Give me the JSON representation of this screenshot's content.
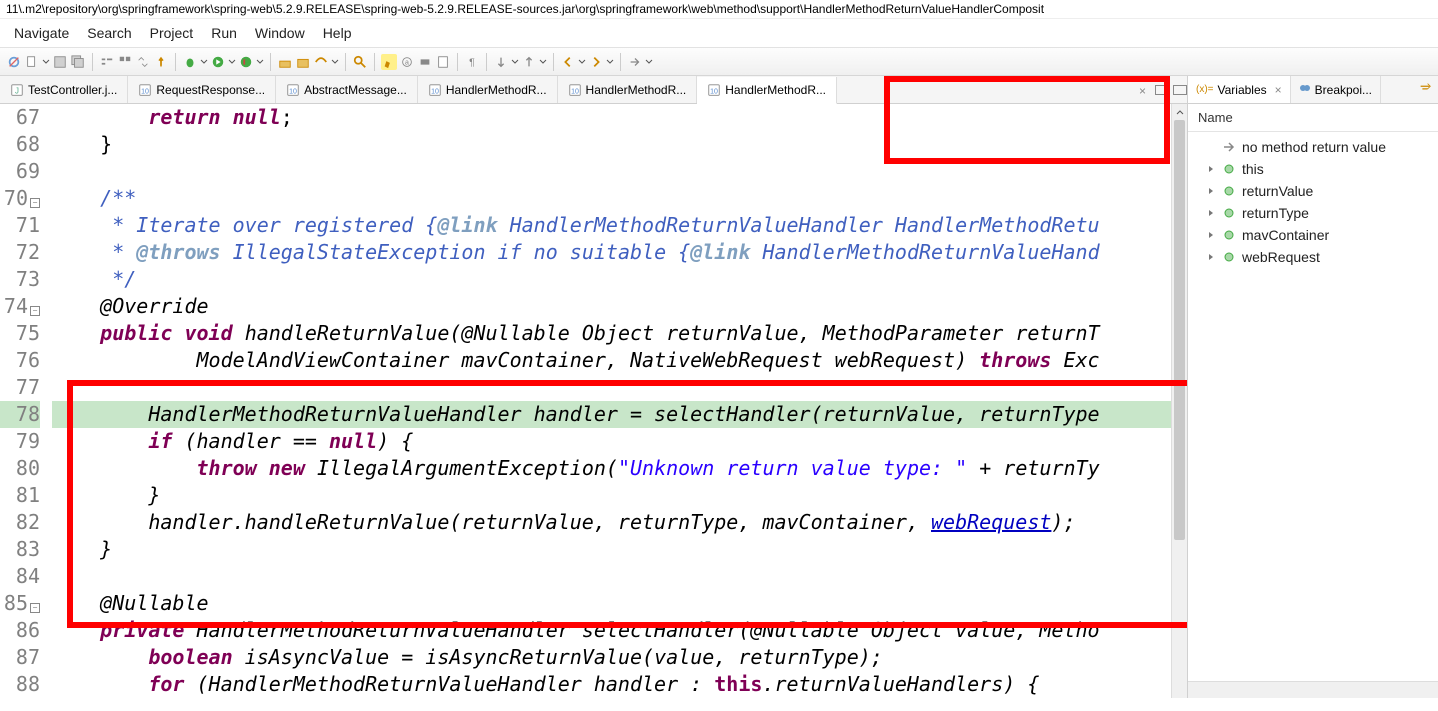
{
  "title": "11\\.m2\\repository\\org\\springframework\\spring-web\\5.2.9.RELEASE\\spring-web-5.2.9.RELEASE-sources.jar\\org\\springframework\\web\\method\\support\\HandlerMethodReturnValueHandlerComposit",
  "menu": [
    "Navigate",
    "Search",
    "Project",
    "Run",
    "Window",
    "Help"
  ],
  "tabs": [
    {
      "label": "TestController.j...",
      "icon": "java"
    },
    {
      "label": "RequestResponse...",
      "icon": "class"
    },
    {
      "label": "AbstractMessage...",
      "icon": "class"
    },
    {
      "label": "HandlerMethodR...",
      "icon": "class"
    },
    {
      "label": "HandlerMethodR...",
      "icon": "class"
    },
    {
      "label": "HandlerMethodR...",
      "icon": "class",
      "active": true
    }
  ],
  "tab_tools": {
    "close_x": "×"
  },
  "code": {
    "lines": [
      {
        "n": 67,
        "html": "        <span class='kw'>return</span> <span class='kw'>null</span>;"
      },
      {
        "n": 68,
        "html": "    }"
      },
      {
        "n": 69,
        "html": ""
      },
      {
        "n": 70,
        "html": "    <span class='jd'>/**</span>",
        "fold": true
      },
      {
        "n": 71,
        "html": "    <span class='jd'> * Iterate over registered {</span><span class='cmtag'>@link</span><span class='jd'> HandlerMethodReturnValueHandler HandlerMethodRetu</span>"
      },
      {
        "n": 72,
        "html": "    <span class='jd'> * </span><span class='cmtag'>@throws</span><span class='jd'> IllegalStateException if no suitable {</span><span class='cmtag'>@link</span><span class='jd'> HandlerMethodReturnValueHand</span>"
      },
      {
        "n": 73,
        "html": "    <span class='jd'> */</span>"
      },
      {
        "n": 74,
        "html": "    <span class='id'>@Override</span>",
        "fold": true
      },
      {
        "n": 75,
        "html": "    <span class='kw'>public</span> <span class='kw'>void</span> <span class='id'>handleReturnValue(@Nullable Object returnValue, MethodParameter returnT</span>"
      },
      {
        "n": 76,
        "html": "            <span class='id'>ModelAndViewContainer mavContainer, NativeWebRequest webRequest)</span> <span class='kw'>throws</span> <span class='id'>Exc</span>"
      },
      {
        "n": 77,
        "html": ""
      },
      {
        "n": 78,
        "html": "        <span class='id'>HandlerMethodReturnValueHandler handler = selectHandler(returnValue, returnType</span>",
        "hl": true
      },
      {
        "n": 79,
        "html": "        <span class='kw'>if</span> <span class='id'>(handler == </span><span class='kw'>null</span><span class='id'>) {</span>"
      },
      {
        "n": 80,
        "html": "            <span class='kw'>throw</span> <span class='kw'>new</span> <span class='id'>IllegalArgumentException(</span><span class='str'>\"Unknown return value type: \"</span><span class='id'> + returnTy</span>"
      },
      {
        "n": 81,
        "html": "        <span class='id'>}</span>"
      },
      {
        "n": 82,
        "html": "        <span class='id'>handler.handleReturnValue(returnValue, returnType, mavContainer, </span><span class='lnk'>webRequest</span><span class='id'>);</span>"
      },
      {
        "n": 83,
        "html": "    <span class='id'>}</span>"
      },
      {
        "n": 84,
        "html": ""
      },
      {
        "n": 85,
        "html": "    <span class='id'>@Nullable</span>",
        "fold": true
      },
      {
        "n": 86,
        "html": "    <span class='kw'>private</span> <span class='id'>HandlerMethodReturnValueHandler selectHandler(@Nullable Object value, Metho</span>"
      },
      {
        "n": 87,
        "html": "        <span class='kw'>boolean</span> <span class='id'>isAsyncValue = isAsyncReturnValue(value, returnType);</span>"
      },
      {
        "n": 88,
        "html": "        <span class='kw'>for</span> <span class='id'>(HandlerMethodReturnValueHandler handler : </span><span class='kwn'>this</span><span class='id'>.returnValueHandlers) {</span>"
      }
    ]
  },
  "right": {
    "tabs": [
      {
        "label": "Variables",
        "active": true,
        "prefix": "(x)="
      },
      {
        "label": "Breakpoi...",
        "active": false
      }
    ],
    "header": "Name",
    "close_x": "×",
    "vars": [
      {
        "label": "no method return value",
        "icon": "ret",
        "twisty": false
      },
      {
        "label": "this",
        "icon": "obj",
        "twisty": true
      },
      {
        "label": "returnValue",
        "icon": "obj",
        "twisty": true
      },
      {
        "label": "returnType",
        "icon": "obj",
        "twisty": true
      },
      {
        "label": "mavContainer",
        "icon": "obj",
        "twisty": true
      },
      {
        "label": "webRequest",
        "icon": "obj",
        "twisty": true
      }
    ]
  }
}
